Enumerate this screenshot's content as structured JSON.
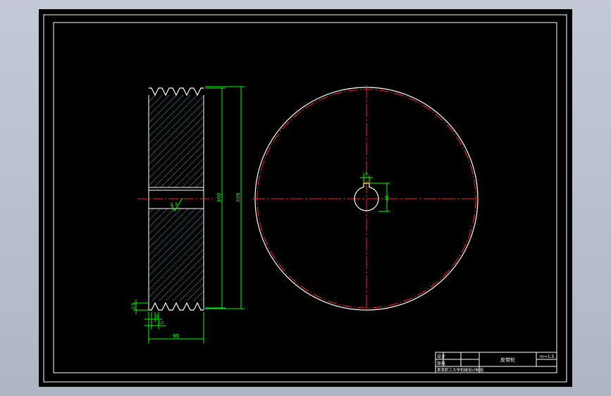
{
  "drawing": {
    "title_block": {
      "part_name": "皮带轮",
      "scale": "m=1.5",
      "label_design": "设计",
      "label_check": "审核",
      "school": "某某职工大学机械设计制造"
    },
    "dimensions": {
      "overall_diameter": "308",
      "pitch_diameter": "300",
      "width": "95",
      "keyway_width": "14",
      "keyway_depth": "48",
      "roughness": "6.3",
      "groove_pitch": "10",
      "groove_depth": "2.5",
      "groove_edge": "5"
    },
    "colors": {
      "background": "#000000",
      "border": "#ffffff",
      "hatch": "#4f8a8a",
      "dimension": "#00ff00",
      "centerline": "#ff2020",
      "keyway": "#ffff00"
    }
  }
}
